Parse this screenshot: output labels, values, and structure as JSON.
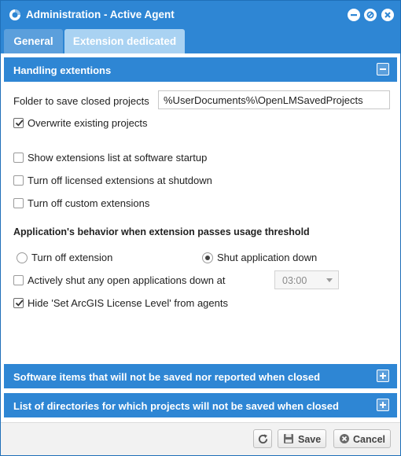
{
  "window": {
    "title": "Administration - Active Agent",
    "logo_icon": "app-logo-icon",
    "buttons": [
      "minimize-icon",
      "restore-icon",
      "close-icon"
    ],
    "accent_color": "#2e86d4"
  },
  "tabs": [
    {
      "label": "General",
      "active": false
    },
    {
      "label": "Extension dedicated",
      "active": true
    }
  ],
  "handling": {
    "title": "Handling extentions",
    "folder_label": "Folder to save closed projects",
    "folder_value": "%UserDocuments%\\OpenLMSavedProjects",
    "overwrite_label": "Overwrite existing projects",
    "overwrite_checked": true,
    "show_list_label": "Show extensions list at software startup",
    "show_list_checked": false,
    "turn_off_licensed_label": "Turn off licensed extensions at shutdown",
    "turn_off_licensed_checked": false,
    "turn_off_custom_label": "Turn off custom extensions",
    "turn_off_custom_checked": false,
    "behavior_title": "Application's behavior when extension passes usage threshold",
    "radio_turn_off": "Turn off extension",
    "radio_shut_down": "Shut application down",
    "selected_radio": "Shut application down",
    "actively_shut_label": "Actively shut any open applications down at",
    "actively_shut_checked": false,
    "time_value": "03:00",
    "hide_arcgis_label": "Hide 'Set ArcGIS License Level' from agents",
    "hide_arcgis_checked": true
  },
  "sections": {
    "software_items": "Software items that will not be saved nor reported when closed",
    "directories": "List of directories for which projects will not be saved when closed"
  },
  "footer": {
    "refresh_icon": "refresh-icon",
    "save_label": "Save",
    "cancel_label": "Cancel"
  }
}
